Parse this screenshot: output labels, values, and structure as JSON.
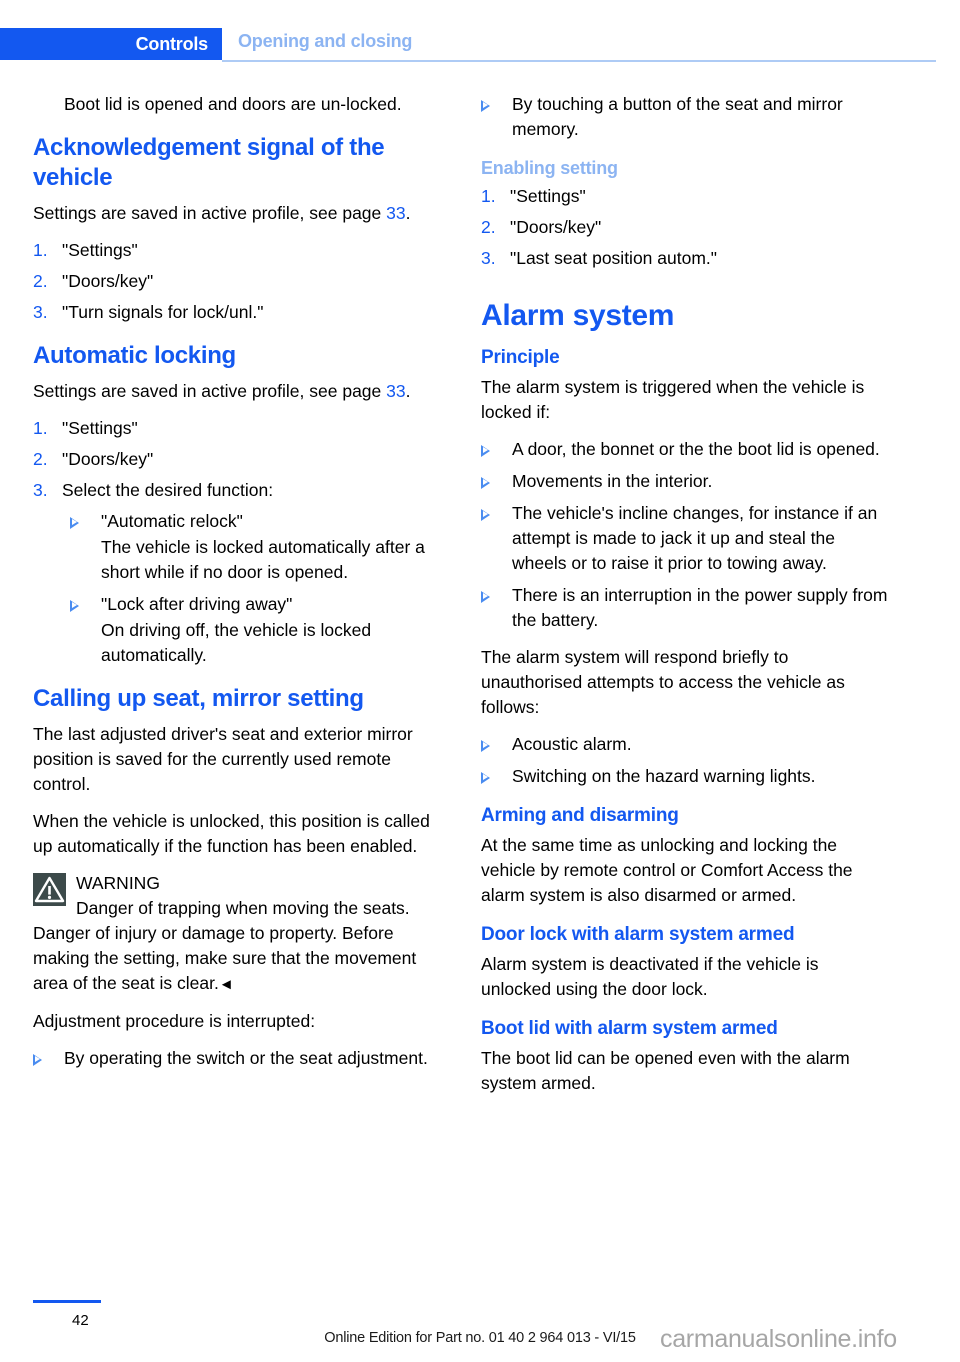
{
  "header": {
    "chapter": "Controls",
    "section": "Opening and closing"
  },
  "left_column": {
    "intro_continued": "Boot lid is opened and doors are un-locked.",
    "section_ack": {
      "heading": "Acknowledgement signal of the vehicle",
      "intro_before": "Settings are saved in active profile, see page ",
      "intro_pageref": "33",
      "intro_after": ".",
      "steps": [
        {
          "marker": "1.",
          "text": "\"Settings\""
        },
        {
          "marker": "2.",
          "text": "\"Doors/key\""
        },
        {
          "marker": "3.",
          "text": "\"Turn signals for lock/unl.\""
        }
      ]
    },
    "section_autolock": {
      "heading": "Automatic locking",
      "intro_before": "Settings are saved in active profile, see page ",
      "intro_pageref": "33",
      "intro_after": ".",
      "steps": [
        {
          "marker": "1.",
          "text": "\"Settings\""
        },
        {
          "marker": "2.",
          "text": "\"Doors/key\""
        },
        {
          "marker": "3.",
          "text": "Select the desired function:"
        }
      ],
      "sub_options": [
        {
          "title": "\"Automatic relock\"",
          "desc": "The vehicle is locked automatically after a short while if no door is opened."
        },
        {
          "title": "\"Lock after driving away\"",
          "desc": "On driving off, the vehicle is locked automatically."
        }
      ]
    },
    "section_calling": {
      "heading": "Calling up seat, mirror setting",
      "para_1": "The last adjusted driver's seat and exterior mirror position is saved for the currently used remote control.",
      "para_2": "When the vehicle is unlocked, this position is called up automatically if the function has been enabled.",
      "warning": {
        "label": "WARNING",
        "text": "Danger of trapping when moving the seats. Danger of injury or damage to property. Before making the setting, make sure that the movement area of the seat is clear.",
        "end_marker": "◄"
      },
      "para_3": "Adjustment procedure is interrupted:",
      "interrupt_items": [
        "By operating the switch or the seat adjustment."
      ]
    }
  },
  "right_column": {
    "interrupt_items_continued": [
      "By touching a button of the seat and mirror memory."
    ],
    "section_enabling": {
      "heading": "Enabling setting",
      "steps": [
        {
          "marker": "1.",
          "text": "\"Settings\""
        },
        {
          "marker": "2.",
          "text": "\"Doors/key\""
        },
        {
          "marker": "3.",
          "text": "\"Last seat position autom.\""
        }
      ]
    },
    "section_alarm": {
      "heading": "Alarm system",
      "principle": {
        "heading": "Principle",
        "intro": "The alarm system is triggered when the vehicle is locked if:",
        "trigger_items": [
          "A door, the bonnet or the the boot lid is opened.",
          "Movements in the interior.",
          "The vehicle's incline changes, for instance if an attempt is made to jack it up and steal the wheels or to raise it prior to towing away.",
          "There is an interruption in the power supply from the battery."
        ],
        "response_intro": "The alarm system will respond briefly to unauthorised attempts to access the vehicle as follows:",
        "response_items": [
          "Acoustic alarm.",
          "Switching on the hazard warning lights."
        ]
      },
      "arming": {
        "heading": "Arming and disarming",
        "text": "At the same time as unlocking and locking the vehicle by remote control or Comfort Access the alarm system is also disarmed or armed."
      },
      "door_lock": {
        "heading": "Door lock with alarm system armed",
        "text": "Alarm system is deactivated if the vehicle is unlocked using the door lock."
      },
      "boot_lid": {
        "heading": "Boot lid with alarm system armed",
        "text": "The boot lid can be opened even with the alarm system armed."
      }
    }
  },
  "footer": {
    "page_number": "42",
    "edition_text": "Online Edition for Part no. 01 40 2 964 013 - VI/15",
    "watermark": "carmanualsonline.info"
  },
  "colors": {
    "primary_blue": "#1358f0",
    "light_blue": "#8cb4f2",
    "rule_blue": "#aecbf5",
    "warning_icon_bg": "#3c4a4a"
  }
}
